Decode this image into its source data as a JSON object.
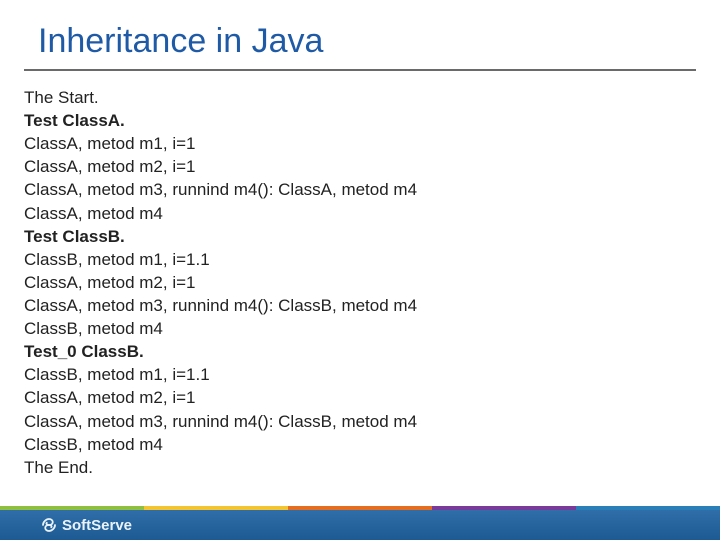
{
  "title": "Inheritance in Java",
  "lines": [
    {
      "text": "The Start.",
      "bold": false
    },
    {
      "text": "Test ClassA.",
      "bold": true
    },
    {
      "text": "ClassA, metod m1, i=1",
      "bold": false
    },
    {
      "text": "ClassA, metod m2, i=1",
      "bold": false
    },
    {
      "text": "ClassA, metod m3, runnind m4(): ClassA, metod m4",
      "bold": false
    },
    {
      "text": "ClassA, metod m4",
      "bold": false
    },
    {
      "text": "Test ClassB.",
      "bold": true
    },
    {
      "text": "ClassB, metod m1, i=1.1",
      "bold": false
    },
    {
      "text": "ClassA, metod m2, i=1",
      "bold": false
    },
    {
      "text": "ClassA, metod m3, runnind m4(): ClassB, metod m4",
      "bold": false
    },
    {
      "text": "ClassB, metod m4",
      "bold": false
    },
    {
      "text": "Test_0 ClassB.",
      "bold": true
    },
    {
      "text": "ClassB, metod m1, i=1.1",
      "bold": false
    },
    {
      "text": "ClassA, metod m2, i=1",
      "bold": false
    },
    {
      "text": "ClassA, metod m3, runnind m4(): ClassB, metod m4",
      "bold": false
    },
    {
      "text": "ClassB, metod m4",
      "bold": false
    },
    {
      "text": "The End.",
      "bold": false
    }
  ],
  "footer": {
    "brand": "SoftServe"
  }
}
